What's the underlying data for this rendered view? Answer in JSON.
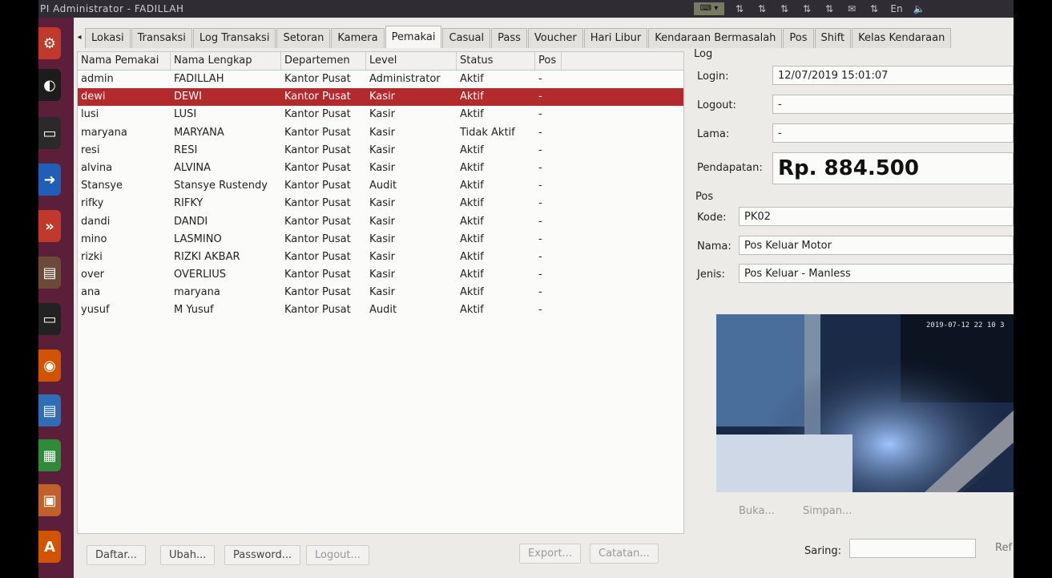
{
  "window": {
    "title": "PI Administrator - FADILLAH"
  },
  "tabs": [
    "Lokasi",
    "Transaksi",
    "Log Transaksi",
    "Setoran",
    "Kamera",
    "Pemakai",
    "Casual",
    "Pass",
    "Voucher",
    "Hari Libur",
    "Kendaraan Bermasalah",
    "Pos",
    "Shift",
    "Kelas Kendaraan"
  ],
  "active_tab": "Pemakai",
  "table": {
    "columns": [
      "Nama Pemakai",
      "Nama Lengkap",
      "Departemen",
      "Level",
      "Status",
      "Pos"
    ],
    "rows": [
      [
        "admin",
        "FADILLAH",
        "Kantor Pusat",
        "Administrator",
        "Aktif",
        "-"
      ],
      [
        "dewi",
        "DEWI",
        "Kantor Pusat",
        "Kasir",
        "Aktif",
        "-"
      ],
      [
        "lusi",
        "LUSI",
        "Kantor Pusat",
        "Kasir",
        "Aktif",
        "-"
      ],
      [
        "maryana",
        "MARYANA",
        "Kantor Pusat",
        "Kasir",
        "Tidak Aktif",
        "-"
      ],
      [
        "resi",
        "RESI",
        "Kantor Pusat",
        "Kasir",
        "Aktif",
        "-"
      ],
      [
        "alvina",
        "ALVINA",
        "Kantor Pusat",
        "Kasir",
        "Aktif",
        "-"
      ],
      [
        "Stansye",
        "Stansye Rustendy",
        "Kantor Pusat",
        "Audit",
        "Aktif",
        "-"
      ],
      [
        "rifky",
        "RIFKY",
        "Kantor Pusat",
        "Kasir",
        "Aktif",
        "-"
      ],
      [
        "dandi",
        "DANDI",
        "Kantor Pusat",
        "Kasir",
        "Aktif",
        "-"
      ],
      [
        "mino",
        "LASMINO",
        "Kantor Pusat",
        "Kasir",
        "Aktif",
        "-"
      ],
      [
        "rizki",
        "RIZKI AKBAR",
        "Kantor Pusat",
        "Kasir",
        "Aktif",
        "-"
      ],
      [
        "over",
        "OVERLIUS",
        "Kantor Pusat",
        "Kasir",
        "Aktif",
        "-"
      ],
      [
        "ana",
        "maryana",
        "Kantor Pusat",
        "Kasir",
        "Aktif",
        "-"
      ],
      [
        "yusuf",
        "M Yusuf",
        "Kantor Pusat",
        "Audit",
        "Aktif",
        "-"
      ]
    ],
    "selected_row": "dewi"
  },
  "log": {
    "section": "Log",
    "login_label": "Login:",
    "login_value": "12/07/2019 15:01:07",
    "logout_label": "Logout:",
    "logout_value": "-",
    "lama_label": "Lama:",
    "lama_value": "-",
    "pendapatan_label": "Pendapatan:",
    "pendapatan_value": "Rp. 884.500"
  },
  "pos": {
    "section": "Pos",
    "kode_label": "Kode:",
    "kode_value": "PK02",
    "nama_label": "Nama:",
    "nama_value": "Pos Keluar Motor",
    "jenis_label": "Jenis:",
    "jenis_value": "Pos Keluar - Manless"
  },
  "camera": {
    "timestamp": "2019-07-12 22 10 3"
  },
  "camera_buttons": {
    "buka": "Buka...",
    "simpan": "Simpan..."
  },
  "footer": {
    "daftar": "Daftar...",
    "ubah": "Ubah...",
    "password": "Password...",
    "logout": "Logout...",
    "export": "Export...",
    "catatan": "Catatan...",
    "saring_label": "Saring:",
    "ref": "Ref"
  },
  "colors": {
    "selection": "#b42a2c",
    "launcher": "#5b1f3a"
  }
}
